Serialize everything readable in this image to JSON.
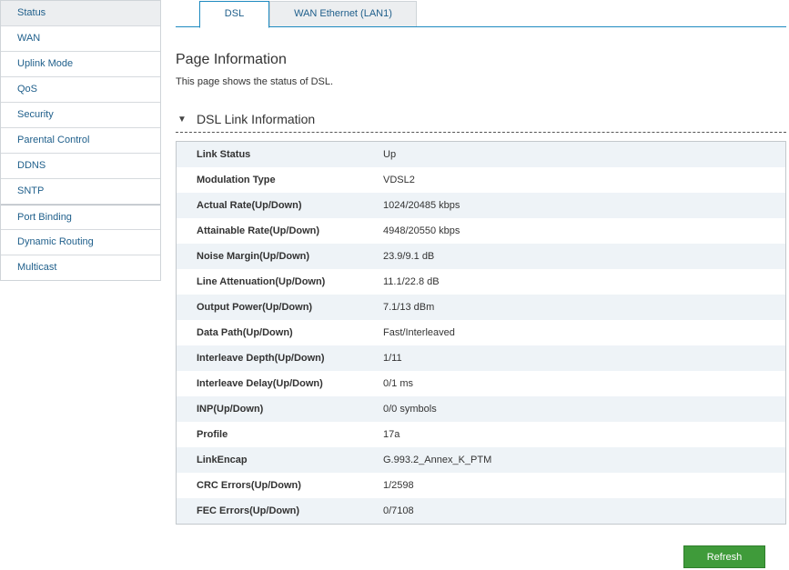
{
  "sidebar": {
    "items": [
      {
        "label": "Status",
        "active": true
      },
      {
        "label": "WAN"
      },
      {
        "label": "Uplink Mode"
      },
      {
        "label": "QoS"
      },
      {
        "label": "Security"
      },
      {
        "label": "Parental Control"
      },
      {
        "label": "DDNS"
      },
      {
        "label": "SNTP"
      },
      {
        "label": "Port Binding"
      },
      {
        "label": "Dynamic Routing"
      },
      {
        "label": "Multicast"
      }
    ]
  },
  "tabs": [
    {
      "label": "DSL",
      "active": true
    },
    {
      "label": "WAN Ethernet (LAN1)"
    }
  ],
  "page": {
    "title": "Page Information",
    "description": "This page shows the status of DSL."
  },
  "section": {
    "arrow_icon": "triangle-down-icon",
    "title": "DSL Link Information"
  },
  "dsl_info": {
    "rows": [
      {
        "label": "Link Status",
        "value": "Up"
      },
      {
        "label": "Modulation Type",
        "value": "VDSL2"
      },
      {
        "label": "Actual Rate(Up/Down)",
        "value": "1024/20485 kbps"
      },
      {
        "label": "Attainable Rate(Up/Down)",
        "value": "4948/20550 kbps"
      },
      {
        "label": "Noise Margin(Up/Down)",
        "value": "23.9/9.1 dB"
      },
      {
        "label": "Line Attenuation(Up/Down)",
        "value": "11.1/22.8 dB"
      },
      {
        "label": "Output Power(Up/Down)",
        "value": "7.1/13 dBm"
      },
      {
        "label": "Data Path(Up/Down)",
        "value": "Fast/Interleaved"
      },
      {
        "label": "Interleave Depth(Up/Down)",
        "value": "1/11"
      },
      {
        "label": "Interleave Delay(Up/Down)",
        "value": "0/1 ms"
      },
      {
        "label": "INP(Up/Down)",
        "value": "0/0 symbols"
      },
      {
        "label": "Profile",
        "value": "17a"
      },
      {
        "label": "LinkEncap",
        "value": "G.993.2_Annex_K_PTM"
      },
      {
        "label": "CRC Errors(Up/Down)",
        "value": "1/2598"
      },
      {
        "label": "FEC Errors(Up/Down)",
        "value": "0/7108"
      }
    ]
  },
  "actions": {
    "refresh_label": "Refresh",
    "refresh_color": "#3f9b3a"
  }
}
